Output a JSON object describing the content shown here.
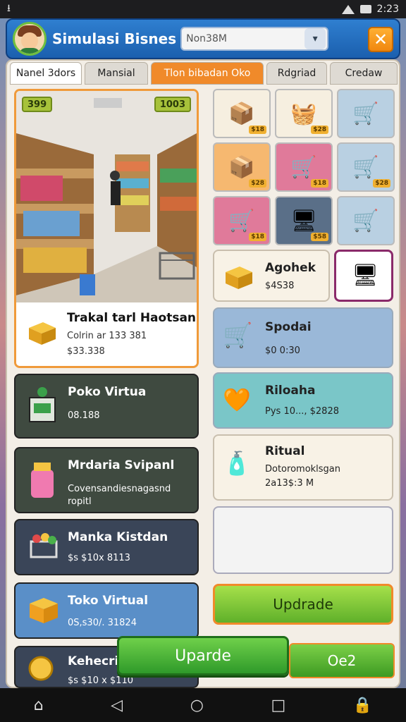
{
  "status_bar": {
    "time": "2:23"
  },
  "header": {
    "title": "Simulasi Bisnes",
    "search_value": "Non38M",
    "dropdown_icon": "chevron-down-icon",
    "close_label": "✕"
  },
  "tabs": [
    "Nanel 3dors",
    "Mansial",
    "Tlon bibadan Oko",
    "Rdgriad",
    "Credaw"
  ],
  "shop": {
    "badge_left": "399",
    "badge_right": "1003",
    "name": "Trakal tarl Haotsan",
    "line1": "Colrin ar 133 381",
    "line2": "$33.338"
  },
  "left_cards": [
    {
      "name": "Poko Virtua",
      "value": "08.188"
    },
    {
      "name": "Mrdaria Svipanl",
      "value": "Covensandiesnagasnd",
      "value2": "ropitl"
    },
    {
      "name": "Manka Kistdan",
      "value": "$s $10x 8113"
    },
    {
      "name": "Toko Virtual",
      "value": "0S,s30/. 31824"
    },
    {
      "name": "Kehecri",
      "value": "$s $10 x $110"
    }
  ],
  "grid_prices": [
    "$18",
    "$28",
    "",
    "$28",
    "$18",
    "$28",
    "$18",
    "$58",
    ""
  ],
  "right_cards": [
    {
      "name": "Agohek",
      "value": "$4S38"
    },
    {
      "name": "Spodai",
      "value": "$0 0:30"
    },
    {
      "name": "Riloaha",
      "value": "Pys 10..., $2828"
    },
    {
      "name": "Ritual",
      "value": "Dotoromoklsgan",
      "value2": "2a13$:3 M"
    }
  ],
  "buttons": {
    "upgrade": "Updrade",
    "floating": "Uparde",
    "bottom": "Oe2"
  },
  "colors": {
    "accent_orange": "#f08a2a",
    "header_blue": "#1b5fae",
    "green_button": "#5fb02a"
  }
}
